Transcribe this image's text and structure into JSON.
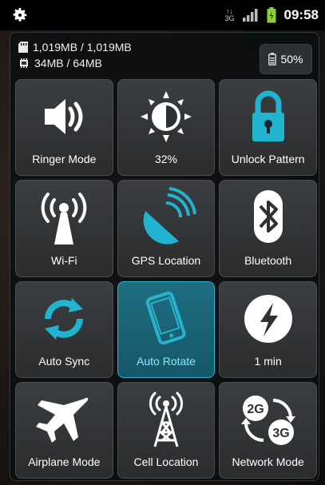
{
  "status_bar": {
    "time": "09:58",
    "network": "3G"
  },
  "info": {
    "storage": "1,019MB / 1,019MB",
    "memory": "34MB / 64MB",
    "battery": "50%"
  },
  "tiles": [
    {
      "label": "Ringer Mode",
      "icon": "speaker-icon"
    },
    {
      "label": "32%",
      "icon": "brightness-icon"
    },
    {
      "label": "Unlock Pattern",
      "icon": "lock-icon"
    },
    {
      "label": "Wi-Fi",
      "icon": "wifi-icon"
    },
    {
      "label": "GPS Location",
      "icon": "satellite-dish-icon"
    },
    {
      "label": "Bluetooth",
      "icon": "bluetooth-icon"
    },
    {
      "label": "Auto Sync",
      "icon": "sync-icon"
    },
    {
      "label": "Auto Rotate",
      "icon": "rotate-phone-icon",
      "active": true
    },
    {
      "label": "1 min",
      "icon": "timeout-icon"
    },
    {
      "label": "Airplane Mode",
      "icon": "airplane-icon"
    },
    {
      "label": "Cell Location",
      "icon": "cell-tower-icon"
    },
    {
      "label": "Network Mode",
      "icon": "network-mode-icon",
      "badges": [
        "2G",
        "3G"
      ]
    }
  ],
  "colors": {
    "accent": "#2ab1cc",
    "active_bg": "#1a6476",
    "icon_teal": "#22b3d0",
    "battery_green": "#8bd12a"
  }
}
